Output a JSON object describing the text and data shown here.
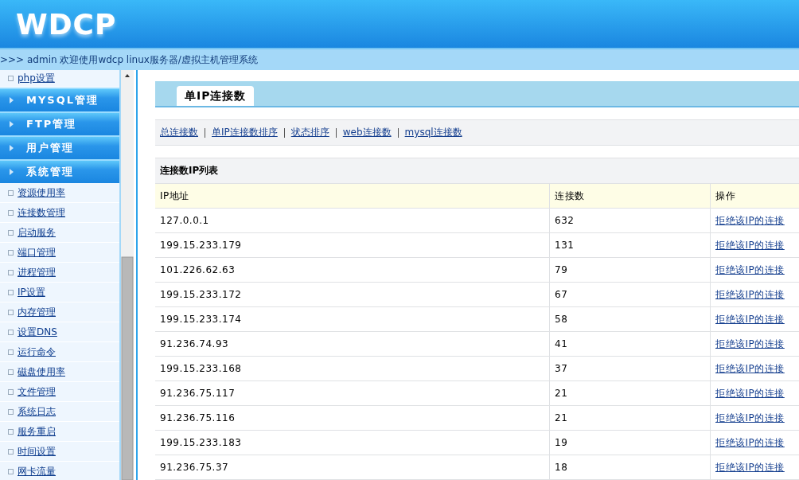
{
  "header": {
    "logo": "WDCP"
  },
  "breadcrumb": ">>> admin 欢迎使用wdcp linux服务器/虚拟主机管理系统",
  "sidebar": {
    "items": [
      {
        "kind": "link",
        "label": "php设置"
      },
      {
        "kind": "group",
        "label": "MYSQL管理"
      },
      {
        "kind": "group",
        "label": "FTP管理"
      },
      {
        "kind": "group",
        "label": "用户管理"
      },
      {
        "kind": "group",
        "label": "系统管理"
      },
      {
        "kind": "link",
        "label": "资源使用率"
      },
      {
        "kind": "link",
        "label": "连接数管理"
      },
      {
        "kind": "link",
        "label": "启动服务"
      },
      {
        "kind": "link",
        "label": "端口管理"
      },
      {
        "kind": "link",
        "label": "进程管理"
      },
      {
        "kind": "link",
        "label": "IP设置"
      },
      {
        "kind": "link",
        "label": "内存管理"
      },
      {
        "kind": "link",
        "label": "设置DNS"
      },
      {
        "kind": "link",
        "label": "运行命令"
      },
      {
        "kind": "link",
        "label": "磁盘使用率"
      },
      {
        "kind": "link",
        "label": "文件管理"
      },
      {
        "kind": "link",
        "label": "系统日志"
      },
      {
        "kind": "link",
        "label": "服务重启"
      },
      {
        "kind": "link",
        "label": "时间设置"
      },
      {
        "kind": "link",
        "label": "网卡流量"
      }
    ]
  },
  "tabs": [
    {
      "label": "单IP连接数",
      "selected": true
    }
  ],
  "links": [
    "总连接数",
    "单IP连接数排序",
    "状态排序",
    "web连接数",
    "mysql连接数"
  ],
  "table": {
    "title": "连接数IP列表",
    "columns": [
      "IP地址",
      "连接数",
      "操作"
    ],
    "rows": [
      {
        "ip": "127.0.0.1",
        "count": "632",
        "action": "拒绝该IP的连接"
      },
      {
        "ip": "199.15.233.179",
        "count": "131",
        "action": "拒绝该IP的连接"
      },
      {
        "ip": "101.226.62.63",
        "count": "79",
        "action": "拒绝该IP的连接"
      },
      {
        "ip": "199.15.233.172",
        "count": "67",
        "action": "拒绝该IP的连接"
      },
      {
        "ip": "199.15.233.174",
        "count": "58",
        "action": "拒绝该IP的连接"
      },
      {
        "ip": "91.236.74.93",
        "count": "41",
        "action": "拒绝该IP的连接"
      },
      {
        "ip": "199.15.233.168",
        "count": "37",
        "action": "拒绝该IP的连接"
      },
      {
        "ip": "91.236.75.117",
        "count": "21",
        "action": "拒绝该IP的连接"
      },
      {
        "ip": "91.236.75.116",
        "count": "21",
        "action": "拒绝该IP的连接"
      },
      {
        "ip": "199.15.233.183",
        "count": "19",
        "action": "拒绝该IP的连接"
      },
      {
        "ip": "91.236.75.37",
        "count": "18",
        "action": "拒绝该IP的连接"
      }
    ]
  }
}
